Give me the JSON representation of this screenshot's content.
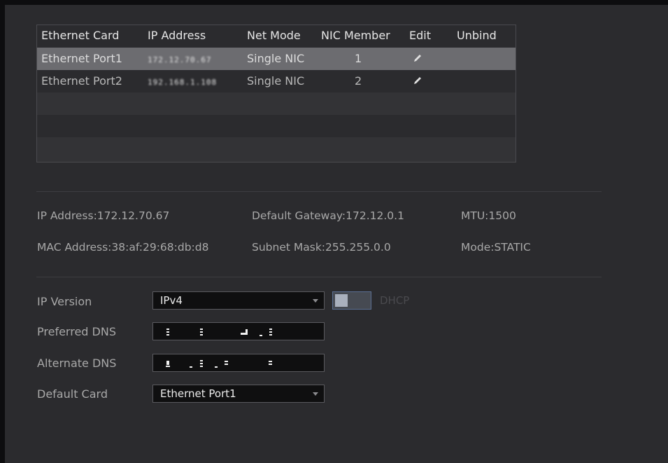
{
  "table": {
    "headers": [
      "Ethernet Card",
      "IP Address",
      "Net Mode",
      "NIC Member",
      "Edit",
      "Unbind"
    ],
    "rows": [
      {
        "card": "Ethernet Port1",
        "ip": "172.12.70.67",
        "mode": "Single NIC",
        "member": "1"
      },
      {
        "card": "Ethernet Port2",
        "ip": "192.168.1.108",
        "mode": "Single NIC",
        "member": "2"
      }
    ]
  },
  "info": {
    "ip_address": "IP Address:172.12.70.67",
    "default_gateway": "Default Gateway:172.12.0.1",
    "mtu": "MTU:1500",
    "mac_address": "MAC Address:38:af:29:68:db:d8",
    "subnet_mask": "Subnet Mask:255.255.0.0",
    "mode": "Mode:STATIC"
  },
  "form": {
    "ip_version_label": "IP Version",
    "ip_version_value": "IPv4",
    "dhcp_label": "DHCP",
    "preferred_dns_label": "Preferred DNS",
    "alternate_dns_label": "Alternate DNS",
    "default_card_label": "Default Card",
    "default_card_value": "Ethernet Port1"
  },
  "icons": {
    "edit": "pencil-icon",
    "dropdown": "chevron-down-icon"
  },
  "colors": {
    "selected_row": "#6c6c70",
    "background": "#2b2b2e",
    "toggle_border": "#5b6f92"
  }
}
